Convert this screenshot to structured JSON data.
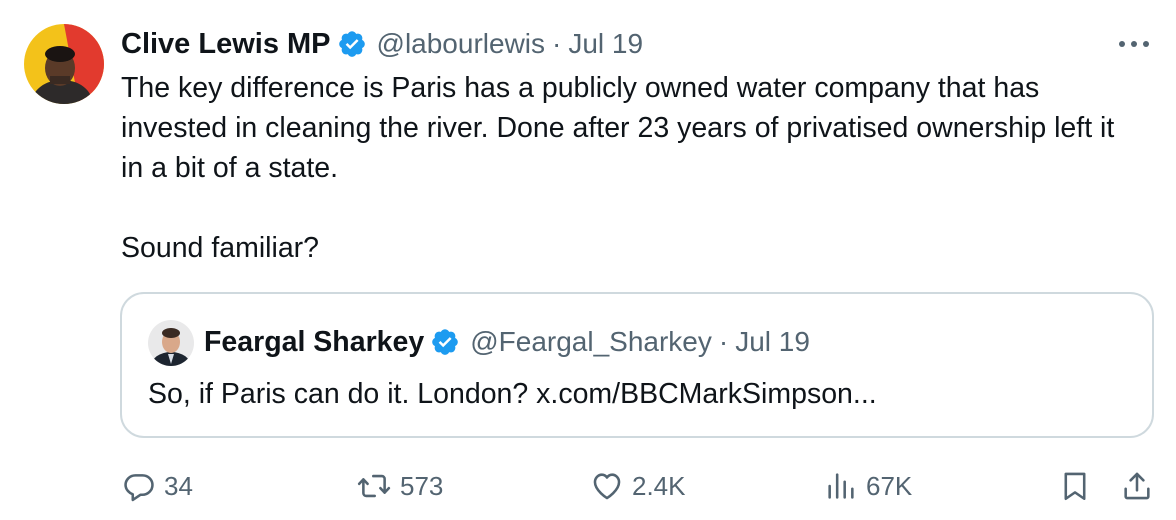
{
  "tweet": {
    "author_name": "Clive Lewis MP",
    "handle": "@labourlewis",
    "separator": "·",
    "date": "Jul 19",
    "paragraphs": [
      "The key difference is Paris has a publicly owned water company that has invested in cleaning the river. Done after 23 years of privatised ownership left it in a bit of a state.",
      "Sound familiar?"
    ],
    "verified_icon": "verified-badge-icon",
    "more_icon": "more-options-icon"
  },
  "quoted_tweet": {
    "author_name": "Feargal Sharkey",
    "handle": "@Feargal_Sharkey",
    "separator": "·",
    "date": "Jul 19",
    "text": "So, if Paris can do it. London? x.com/BBCMarkSimpson..."
  },
  "actions": {
    "replies": "34",
    "reposts": "573",
    "likes": "2.4K",
    "views": "67K",
    "icons": [
      "reply-icon",
      "repost-icon",
      "like-icon",
      "views-icon",
      "bookmark-icon",
      "share-icon"
    ]
  },
  "colors": {
    "text_primary": "#0f1419",
    "text_secondary": "#536471",
    "verified_blue": "#1d9bf0",
    "border": "#cfd9de"
  }
}
